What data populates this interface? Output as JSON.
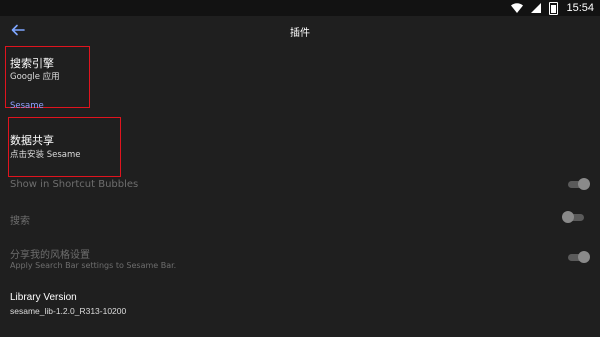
{
  "status_bar": {
    "time": "15:54"
  },
  "app_bar": {
    "title": "插件"
  },
  "search_engine": {
    "title": "搜索引擎",
    "subtitle": "Google 应用"
  },
  "section": {
    "label": "Sesame"
  },
  "data_sharing": {
    "title": "数据共享",
    "subtitle": "点击安装 Sesame"
  },
  "shortcut_bubbles": {
    "title": "Show in Shortcut Bubbles",
    "enabled": true
  },
  "search": {
    "title": "搜索",
    "enabled": false
  },
  "share_style": {
    "title": "分享我的风格设置",
    "subtitle": "Apply Search Bar settings to Sesame Bar.",
    "enabled": true
  },
  "library": {
    "title": "Library Version",
    "version": "sesame_lib-1.2.0_R313-10200"
  },
  "colors": {
    "accent": "#8ea0ff",
    "highlight": "#e0141e",
    "background": "#1f1f1f"
  }
}
